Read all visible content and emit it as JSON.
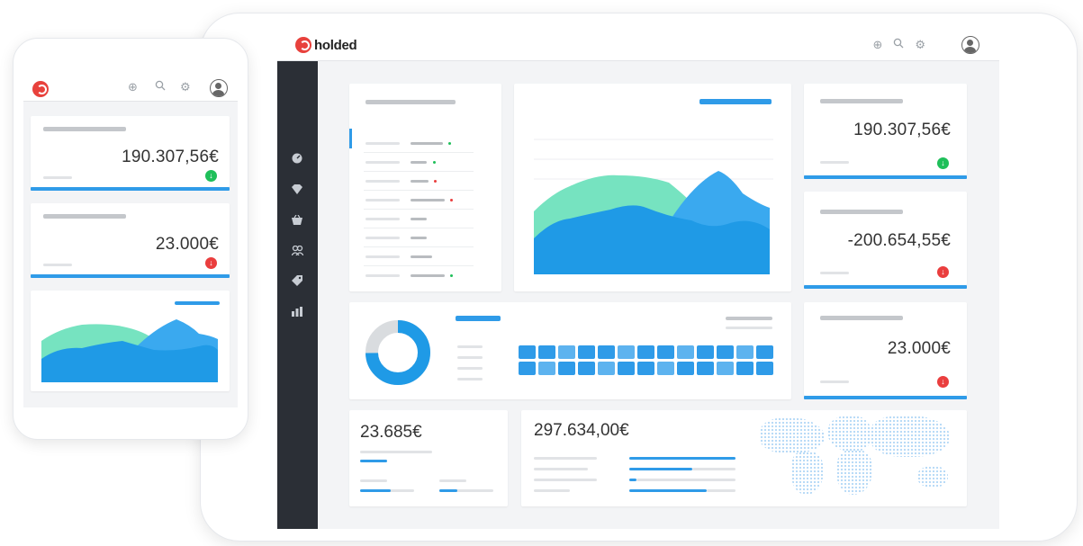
{
  "brand": {
    "name": "holded",
    "accent": "#2f9be8",
    "brand_red": "#e8413c",
    "area_green": "#76e3c0",
    "area_blue": "#1f9ae6",
    "sidebar_bg": "#2b2f36"
  },
  "topbar": {
    "icons": [
      "add-circle-icon",
      "search-icon",
      "gear-icon",
      "user-avatar-icon"
    ]
  },
  "sidebar": {
    "items": [
      "dashboard-icon",
      "diamond-icon",
      "basket-icon",
      "contacts-icon",
      "tag-icon",
      "bar-chart-icon"
    ]
  },
  "desktop": {
    "kpis": [
      {
        "value": "190.307,56€",
        "trend": "up"
      },
      {
        "value": "-200.654,55€",
        "trend": "down"
      },
      {
        "value": "23.000€",
        "trend": "down"
      }
    ],
    "bottom_left_value": "23.685€",
    "bottom_right_value": "297.634,00€"
  },
  "mobile": {
    "kpis": [
      {
        "value": "190.307,56€",
        "trend": "up"
      },
      {
        "value": "23.000€",
        "trend": "down"
      }
    ]
  },
  "trend_icons": {
    "up": "↓",
    "down": "↓"
  }
}
